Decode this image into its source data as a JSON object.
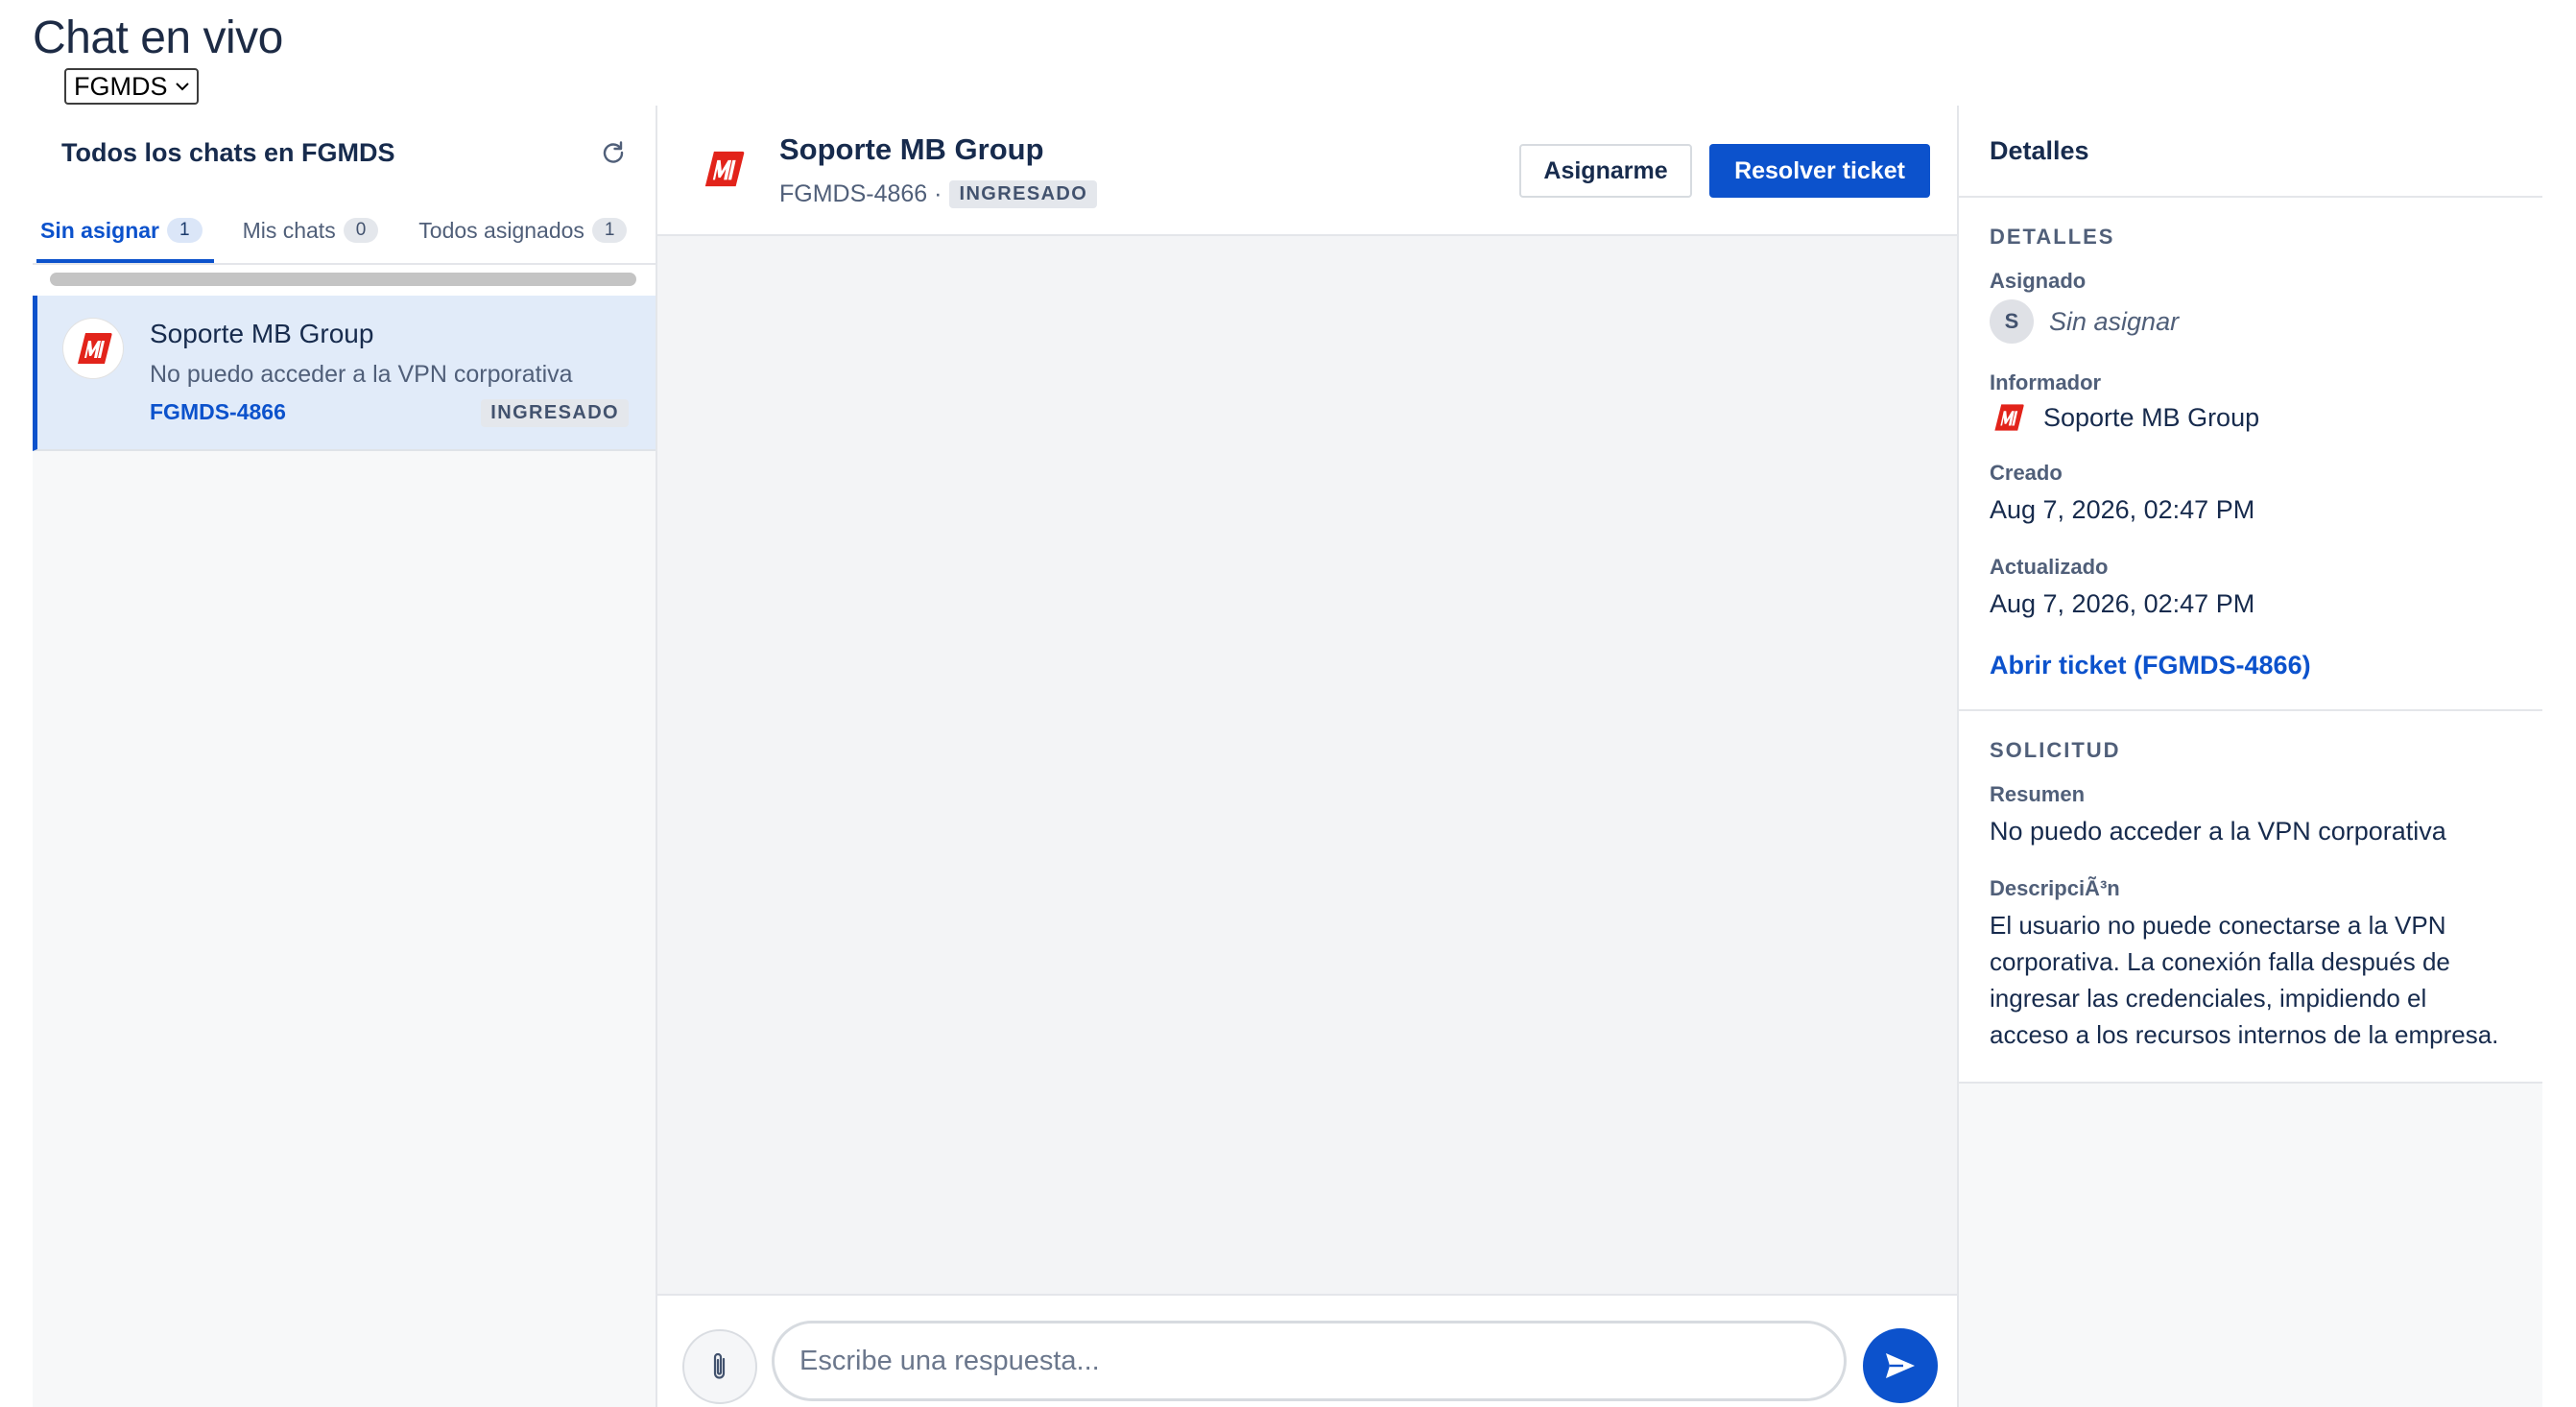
{
  "page": {
    "title": "Chat en vivo"
  },
  "project_selector": {
    "value": "FGMDS"
  },
  "chat_list": {
    "title": "Todos los chats en FGMDS",
    "tabs": [
      {
        "label": "Sin asignar",
        "count": "1"
      },
      {
        "label": "Mis chats",
        "count": "0"
      },
      {
        "label": "Todos asignados",
        "count": "1"
      }
    ],
    "items": [
      {
        "name": "Soporte MB Group",
        "summary": "No puedo acceder a la VPN corporativa",
        "key": "FGMDS-4866",
        "status": "INGRESADO"
      }
    ]
  },
  "conversation": {
    "name": "Soporte MB Group",
    "key": "FGMDS-4866 ·",
    "status": "INGRESADO",
    "assign_label": "Asignarme",
    "resolve_label": "Resolver ticket",
    "reply_placeholder": "Escribe una respuesta..."
  },
  "details": {
    "header": "Detalles",
    "section_title": "DETALLES",
    "assignee_label": "Asignado",
    "assignee_initial": "S",
    "assignee_value": "Sin asignar",
    "reporter_label": "Informador",
    "reporter_value": "Soporte MB Group",
    "created_label": "Creado",
    "created_value": "Aug 7, 2026, 02:47 PM",
    "updated_label": "Actualizado",
    "updated_value": "Aug 7, 2026, 02:47 PM",
    "open_ticket_label": "Abrir ticket (FGMDS-4866)"
  },
  "request": {
    "section_title": "SOLICITUD",
    "summary_label": "Resumen",
    "summary_value": "No puedo acceder a la VPN corporativa",
    "description_label": "DescripciÃ³n",
    "description_value": "El usuario no puede conectarse a la VPN corporativa. La conexión falla después de ingresar las credenciales, impidiendo el acceso a los recursos internos de la empresa."
  },
  "colors": {
    "primary": "#0c52cc",
    "logo_red": "#e2231a"
  },
  "icons": [
    "refresh-icon",
    "chevron-down-icon",
    "mb-logo-icon",
    "paperclip-icon",
    "send-icon"
  ]
}
